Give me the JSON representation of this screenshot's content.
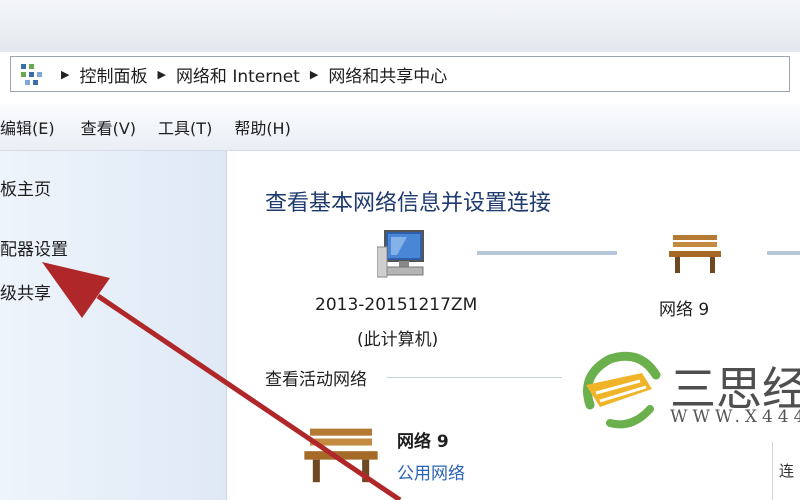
{
  "breadcrumb": {
    "items": [
      "控制面板",
      "网络和 Internet",
      "网络和共享中心"
    ]
  },
  "menu": {
    "items": [
      "编辑(E)",
      "查看(V)",
      "工具(T)",
      "帮助(H)"
    ]
  },
  "sidebar": {
    "links": [
      "板主页",
      "配器设置",
      "级共享"
    ]
  },
  "main": {
    "heading": "查看基本网络信息并设置连接",
    "computer_name": "2013-20151217ZM",
    "computer_caption": "(此计算机)",
    "network_name": "网络  9",
    "active_section_title": "查看活动网络",
    "active_network_name": "网络  9",
    "active_network_type": "公用网络"
  },
  "watermark": {
    "brand": "三思经",
    "url": "WWW.X444"
  },
  "scroll_peek_text": "连",
  "colors": {
    "heading": "#1e3a6e",
    "link": "#2a64b7",
    "arrow": "#b0272a"
  }
}
